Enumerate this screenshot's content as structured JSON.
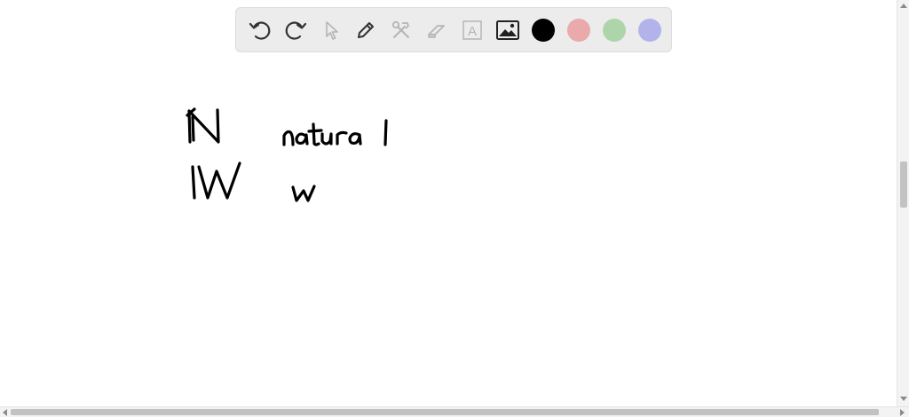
{
  "toolbar": {
    "tools": [
      {
        "name": "undo-icon",
        "enabled": true
      },
      {
        "name": "redo-icon",
        "enabled": true
      },
      {
        "name": "pointer-icon",
        "enabled": false
      },
      {
        "name": "pen-icon",
        "enabled": true
      },
      {
        "name": "tools-icon",
        "enabled": false
      },
      {
        "name": "eraser-icon",
        "enabled": false
      },
      {
        "name": "text-icon",
        "enabled": false
      },
      {
        "name": "image-icon",
        "enabled": true
      }
    ],
    "text_tool_glyph": "A",
    "colors": [
      "#000000",
      "#eaa9ab",
      "#aed5aa",
      "#b1b3ea"
    ],
    "selected_color": "#000000"
  },
  "canvas": {
    "ink_color": "#000000",
    "handwriting": [
      {
        "text": "N"
      },
      {
        "text": "natural"
      },
      {
        "text": "W"
      },
      {
        "text": "w"
      }
    ]
  }
}
